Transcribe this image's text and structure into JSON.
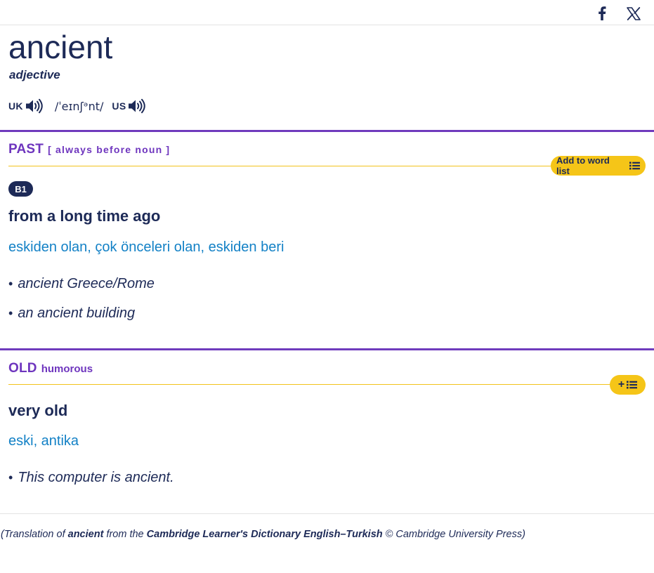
{
  "share": {
    "facebook_icon": "facebook-icon",
    "x_icon": "x-icon"
  },
  "entry": {
    "headword": "ancient",
    "pos": "adjective",
    "pronunciation": {
      "uk_label": "UK",
      "ipa": "/ˈeɪnʃᵊnt/",
      "us_label": "US"
    }
  },
  "senses": [
    {
      "guideword": "PAST",
      "grammar": "[ always before noun ]",
      "add_to_word_list": "Add to word list",
      "level": "B1",
      "definition": "from a long time ago",
      "translation": "eskiden olan, çok önceleri olan, eskiden beri",
      "examples": [
        "ancient Greece/Rome",
        "an ancient building"
      ]
    },
    {
      "guideword": "OLD",
      "usage": "humorous",
      "add_symbol": "+",
      "definition": "very old",
      "translation": "eski, antika",
      "examples": [
        "This computer is ancient."
      ]
    }
  ],
  "credit": {
    "prefix": "(Translation of ",
    "word": "ancient",
    "mid": " from the ",
    "source": "Cambridge Learner's Dictionary English–Turkish",
    "suffix": " © Cambridge University Press)"
  },
  "colors": {
    "navy": "#1d2a57",
    "purple": "#6e35be",
    "yellow": "#f5c518",
    "translation_blue": "#1381c6"
  }
}
